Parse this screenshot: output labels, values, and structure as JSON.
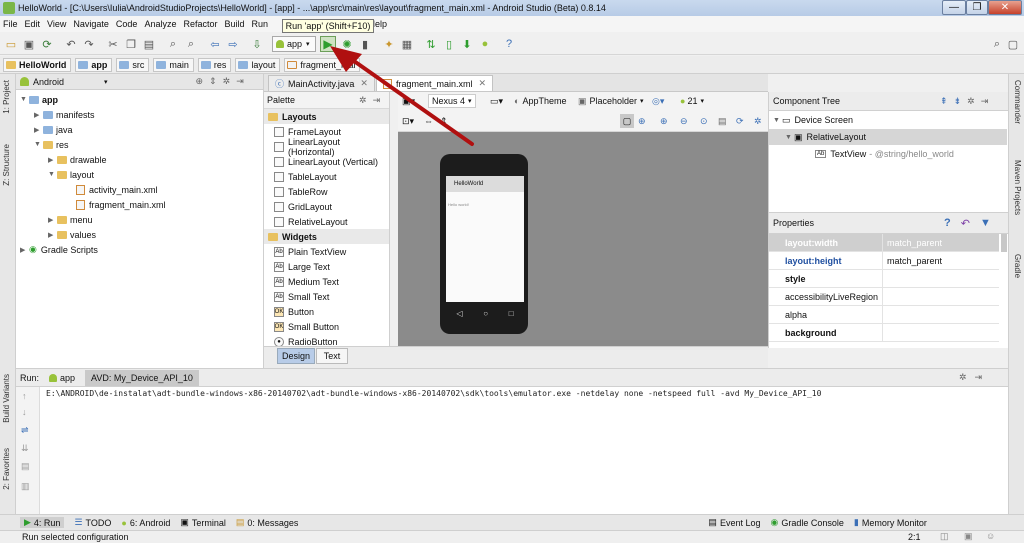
{
  "window": {
    "title": "HelloWorld - [C:\\Users\\Iulia\\AndroidStudioProjects\\HelloWorld] - [app] - ...\\app\\src\\main\\res\\layout\\fragment_main.xml - Android Studio (Beta) 0.8.14",
    "minimize": "—",
    "maximize": "❐",
    "close": "✕"
  },
  "menu": {
    "items": [
      "File",
      "Edit",
      "View",
      "Navigate",
      "Code",
      "Analyze",
      "Refactor",
      "Build",
      "Run",
      "w",
      "Help"
    ]
  },
  "tooltip": "Run 'app' (Shift+F10)",
  "toolbar": {
    "run_config": "app",
    "help_icon": "?"
  },
  "breadcrumb": [
    "HelloWorld",
    "app",
    "src",
    "main",
    "res",
    "layout",
    "fragment_mai"
  ],
  "side_tools": {
    "left": [
      "1: Project",
      "Z: Structure",
      "Build Variants",
      "2: Favorites"
    ],
    "right": [
      "Commander",
      "Maven Projects",
      "Gradle"
    ]
  },
  "project": {
    "view": "Android",
    "tree": [
      {
        "label": "app",
        "bold": true
      },
      {
        "label": "manifests"
      },
      {
        "label": "java"
      },
      {
        "label": "res"
      },
      {
        "label": "drawable"
      },
      {
        "label": "layout"
      },
      {
        "label": "activity_main.xml"
      },
      {
        "label": "fragment_main.xml"
      },
      {
        "label": "menu"
      },
      {
        "label": "values"
      },
      {
        "label": "Gradle Scripts"
      }
    ]
  },
  "editor_tabs": [
    "MainActivity.java",
    "fragment_main.xml"
  ],
  "palette": {
    "title": "Palette",
    "sections": [
      {
        "name": "Layouts",
        "items": [
          "FrameLayout",
          "LinearLayout (Horizontal)",
          "LinearLayout (Vertical)",
          "TableLayout",
          "TableRow",
          "GridLayout",
          "RelativeLayout"
        ]
      },
      {
        "name": "Widgets",
        "items": [
          "Plain TextView",
          "Large Text",
          "Medium Text",
          "Small Text",
          "Button",
          "Small Button",
          "RadioButton"
        ]
      }
    ]
  },
  "design_toolbar": {
    "device": "Nexus 4",
    "theme": "AppTheme",
    "activity": "Placeholder",
    "api": "21"
  },
  "preview": {
    "app_title": "HelloWorld",
    "hello": "Hello world!"
  },
  "design_tabs": [
    "Design",
    "Text"
  ],
  "component_tree": {
    "title": "Component Tree",
    "nodes": [
      "Device Screen",
      "RelativeLayout",
      "TextView",
      "- @string/hello_world"
    ]
  },
  "properties": {
    "title": "Properties",
    "rows": [
      {
        "name": "layout:width",
        "value": "match_parent"
      },
      {
        "name": "layout:height",
        "value": "match_parent"
      },
      {
        "name": "style",
        "value": ""
      },
      {
        "name": "accessibilityLiveRegion",
        "value": ""
      },
      {
        "name": "alpha",
        "value": ""
      },
      {
        "name": "background",
        "value": ""
      }
    ]
  },
  "run_panel": {
    "label": "Run:",
    "tabs": [
      "app",
      "AVD: My_Device_API_10"
    ],
    "command": "E:\\ANDROID\\de-instalat\\adt-bundle-windows-x86-20140702\\adt-bundle-windows-x86-20140702\\sdk\\tools\\emulator.exe -netdelay none -netspeed full -avd My_Device_API_10"
  },
  "bottom_tools": {
    "left": [
      "4: Run",
      "TODO",
      "6: Android",
      "Terminal",
      "0: Messages"
    ],
    "right": [
      "Event Log",
      "Gradle Console",
      "Memory Monitor"
    ]
  },
  "status": {
    "message": "Run selected configuration",
    "position": "2:1"
  },
  "colors": {
    "arrow": "#b01010",
    "run_green": "#2e9d2e",
    "android_green": "#98c23a",
    "selection_blue": "#b8cce8"
  }
}
